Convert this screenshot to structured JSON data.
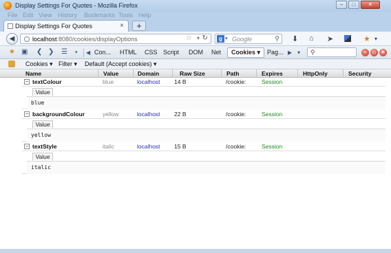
{
  "window": {
    "title": "Display Settings For Quotes - Mozilla Firefox"
  },
  "menubar": {
    "items": [
      "File",
      "Edit",
      "View",
      "History",
      "Bookmarks",
      "Tools",
      "Help"
    ]
  },
  "tabs": [
    {
      "label": "Display Settings For Quotes"
    }
  ],
  "navbar": {
    "url_host": "localhost",
    "url_rest": ":8080/cookies/displayOptions",
    "search_engine": "g",
    "search_placeholder": "Google"
  },
  "firebug": {
    "tabs": [
      "Con...",
      "HTML",
      "CSS",
      "Script",
      "DOM",
      "Net",
      "Cookies ▾",
      "Pag..."
    ],
    "selected_tab": "Cookies ▾"
  },
  "cookies_toolbar": {
    "cookies_menu": "Cookies ▾",
    "filter_menu": "Filter ▾",
    "policy": "Default (Accept cookies) ▾"
  },
  "table": {
    "columns": [
      "Name",
      "Value",
      "Domain",
      "Raw Size",
      "Path",
      "Expires",
      "HttpOnly",
      "Security"
    ],
    "rows": [
      {
        "toggle": "−",
        "name": "textColour",
        "value": "blue",
        "domain": "localhost",
        "raw_size": "14 B",
        "path": "/cookie:",
        "expires": "Session",
        "detail_tab": "Value",
        "detail_value": "blue"
      },
      {
        "toggle": "−",
        "name": "backgroundColour",
        "value": "yellow",
        "domain": "localhost",
        "raw_size": "22 B",
        "path": "/cookie:",
        "expires": "Session",
        "detail_tab": "Value",
        "detail_value": "yellow"
      },
      {
        "toggle": "−",
        "name": "textStyle",
        "value": "italic",
        "domain": "localhost",
        "raw_size": "15 B",
        "path": "/cookie:",
        "expires": "Session",
        "detail_tab": "Value",
        "detail_value": "italic"
      }
    ]
  },
  "icons": {
    "back": "back-arrow-icon",
    "globe": "globe-icon",
    "bookmark_star": "bookmark-star-icon",
    "reload": "reload-icon",
    "search": "magnifier-icon",
    "download": "download-icon",
    "home": "home-icon",
    "close": "close-icon"
  },
  "colors": {
    "accent_selected_tab": "#ffffff",
    "domain_link": "#2b2bb3",
    "expires_text": "#1e8a1e",
    "titlebar": "#b9d1ea"
  }
}
